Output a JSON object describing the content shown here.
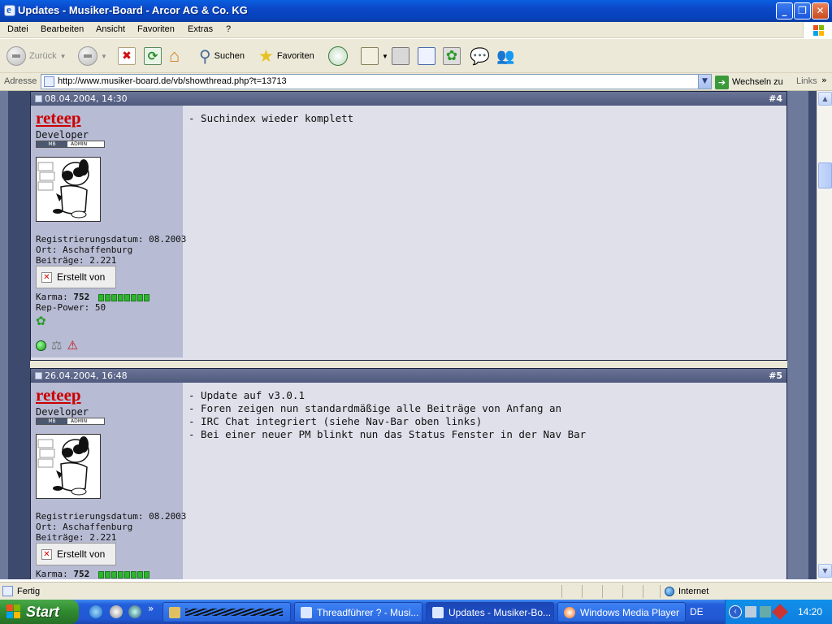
{
  "window": {
    "title": "Updates - Musiker-Board - Arcor AG & Co. KG"
  },
  "menu": [
    "Datei",
    "Bearbeiten",
    "Ansicht",
    "Favoriten",
    "Extras",
    "?"
  ],
  "toolbar": {
    "back": "Zurück",
    "search": "Suchen",
    "favorites": "Favoriten"
  },
  "address": {
    "label": "Adresse",
    "url": "http://www.musiker-board.de/vb/showthread.php?t=13713",
    "go": "Wechseln zu",
    "links": "Links"
  },
  "posts": [
    {
      "date": "08.04.2004, 14:30",
      "num": "#4",
      "username": "reteep",
      "role": "Developer",
      "badge_left": "MB",
      "badge_right": "ADMIN",
      "reg": "Registrierungsdatum: 08.2003",
      "ort": "Ort: Aschaffenburg",
      "beitraege": "Beiträge: 2.221",
      "created": "Erstellt von",
      "karma_label": "Karma:",
      "karma": "752",
      "rep": "Rep-Power: 50",
      "message": "- Suchindex wieder komplett"
    },
    {
      "date": "26.04.2004, 16:48",
      "num": "#5",
      "username": "reteep",
      "role": "Developer",
      "badge_left": "MB",
      "badge_right": "ADMIN",
      "reg": "Registrierungsdatum: 08.2003",
      "ort": "Ort: Aschaffenburg",
      "beitraege": "Beiträge: 2.221",
      "created": "Erstellt von",
      "karma_label": "Karma:",
      "karma": "752",
      "message": "- Update auf v3.0.1\n- Foren zeigen nun standardmäßige alle Beiträge von Anfang an\n- IRC Chat integriert (siehe Nav-Bar oben links)\n- Bei einer neuer PM blinkt nun das Status Fenster in der Nav Bar"
    }
  ],
  "status": {
    "text": "Fertig",
    "zone": "Internet"
  },
  "taskbar": {
    "start": "Start",
    "tasks": [
      "Threadführer ? - Musi...",
      "Updates - Musiker-Bo...",
      "Windows Media Player"
    ],
    "lang": "DE",
    "clock": "14:20"
  }
}
